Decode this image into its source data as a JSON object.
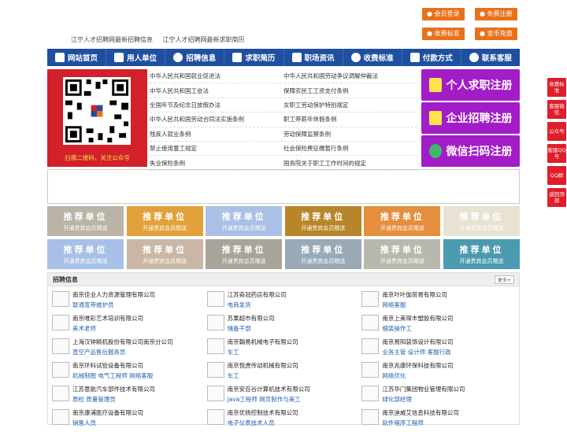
{
  "header": {
    "links": [
      "江宁人才招聘网最新招聘信息",
      "江宁人才招聘网最新求职简历"
    ],
    "buttons": {
      "member_login": "会员登录",
      "free_register": "免费注册",
      "fee_standard": "收费标准",
      "gold_recharge": "金币充值"
    }
  },
  "nav": [
    "网站首页",
    "用人单位",
    "招聘信息",
    "求职简历",
    "职场资讯",
    "收费标准",
    "付款方式",
    "联系客服"
  ],
  "qr": {
    "caption": "扫描二维码，关注公众号"
  },
  "laws": [
    [
      "中华人民共和国就业促进法",
      "中华人民共和国劳动争议调解仲裁法"
    ],
    [
      "中华人民共和国工会法",
      "保障农民工工资支付条例"
    ],
    [
      "全国年节及纪念日放假办法",
      "女职工劳动保护特别规定"
    ],
    [
      "中华人民共和国劳动合同法实施条例",
      "职工带薪年休假条例"
    ],
    [
      "残疾人就业条例",
      "劳动保障监察条例"
    ],
    [
      "禁止使用童工规定",
      "社会保险费征缴暂行条例"
    ],
    [
      "失业保险条例",
      "国务院关于职工工作时间的规定"
    ]
  ],
  "register": [
    "个人求职注册",
    "企业招聘注册",
    "微信扫码注册"
  ],
  "tiles": {
    "title": "推荐单位",
    "subtitle": "开通贵宾会员赠送"
  },
  "tile_colors": [
    "#b9b4a6",
    "#e3a13c",
    "#aac0e6",
    "#b8862a",
    "#e58e3e",
    "#e8e2d2",
    "#a8c0e8",
    "#c9b6a4",
    "#a9a49a",
    "#9aa9b6",
    "#b8b8ae",
    "#4a9ab0"
  ],
  "jobs": {
    "title": "招聘信息",
    "more": "更多+",
    "items": [
      {
        "company": "南京佳业人力资源管理有限公司",
        "position": "联通宽带维护员"
      },
      {
        "company": "江苏奇冠药店有限公司",
        "position": "电商发货"
      },
      {
        "company": "南京叶叶伽贸易有限公司",
        "position": "网络客服"
      },
      {
        "company": "南京唯彩艺术培训有限公司",
        "position": "美术老师"
      },
      {
        "company": "苏果超市有限公司",
        "position": "储备干部"
      },
      {
        "company": "南京上美琛丰塑胶有限公司",
        "position": "细装操作工"
      },
      {
        "company": "上海汉钟精机股份有限公司南京分公司",
        "position": "直空产品售后服务员"
      },
      {
        "company": "南京翰易机械电子有限公司",
        "position": "车工"
      },
      {
        "company": "南京易阳装饰设计有限公司",
        "position": "业务主管 设计师 客服行政"
      },
      {
        "company": "南京环科试验设备有限公司",
        "position": "机械制图 电气工程师 网络客服"
      },
      {
        "company": "南京悦虎传动机械有限公司",
        "position": "车工"
      },
      {
        "company": "南京兆康环保科技有限公司",
        "position": "网络优化"
      },
      {
        "company": "江苏意航汽车部件技术有限公司",
        "position": "质检 质量管理员"
      },
      {
        "company": "南京安百谷计算机技术有限公司",
        "position": "java工程师 网页制作与美工"
      },
      {
        "company": "江苏华门集团物业管理有限公司",
        "position": "绿化部经理"
      },
      {
        "company": "南京康浦医疗设备有限公司",
        "position": "销售人员"
      },
      {
        "company": "南京优扬控制技术有限公司",
        "position": "电子仪表技术人员"
      },
      {
        "company": "南京迪威艾信息科技有限公司",
        "position": "软件程序工程师"
      }
    ]
  },
  "side": [
    "收费标准",
    "客服微信",
    "公众号",
    "客服QQ号",
    "QQ群",
    "返回顶部"
  ]
}
